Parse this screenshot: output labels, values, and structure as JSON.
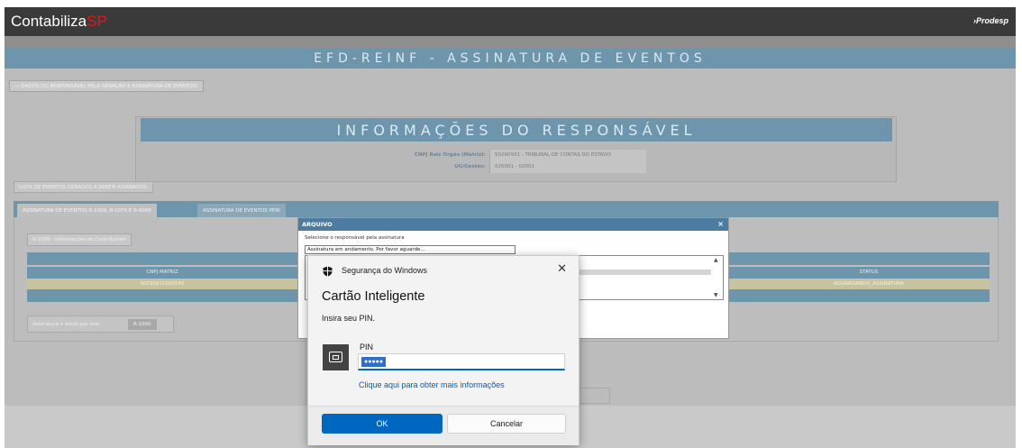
{
  "brand": {
    "name": "Contabiliza",
    "suffix": "SP",
    "partner": "Prodesp"
  },
  "page": {
    "title": "EFD-REINF - ASSINATURA DE EVENTOS",
    "section_dados": "DADOS DO RESPONSÁVEL PELA GERAÇÃO E ASSINATURA DE EVENTOS:",
    "responsavel": {
      "title": "INFORMAÇÕES DO RESPONSÁVEL",
      "rows": [
        {
          "label": "CNPJ Raiz Órgão (Matriz):",
          "value": "50290931 - TRIBUNAL DE CONTAS DO ESTADO"
        },
        {
          "label": "UG/Gestão:",
          "value": "020001 - 02001"
        }
      ]
    },
    "lista_label": "LISTA DE EVENTOS GERADOS A SEREM ASSINADOS:",
    "tabs": [
      {
        "label": "ASSINATURA DE EVENTOS R-1000, R-1070 E R-9000"
      },
      {
        "label": "ASSINATURA DE EVENTOS PERI"
      }
    ],
    "contribuinte_label": "R-1000 - Informações do Contribuinte",
    "table": {
      "headers": [
        "CNPJ MATRIZ",
        "STATUS"
      ],
      "row": [
        "50290931000140",
        "AGUARDANDO_ASSINATURA"
      ]
    },
    "lote_label": "Assinatura e envio por lote",
    "lote_button": "R-1000"
  },
  "arquivo_dialog": {
    "title": "ARQUIVO",
    "close": "×",
    "prompt": "Selecione o responsável pela assinatura",
    "status": "Assinatura em andamento. Por favor aguarde..."
  },
  "security_dialog": {
    "header": "Segurança do Windows",
    "close": "✕",
    "title": "Cartão Inteligente",
    "subtitle": "Insira seu PIN.",
    "pin_label": "PIN",
    "pin_value": "●●●●●",
    "link": "Clique aqui para obter mais informações",
    "ok": "OK",
    "cancel": "Cancelar"
  },
  "colors": {
    "topbar": "#3a3a3a",
    "brand_accent": "#e8141e",
    "title_band": "#6d96ac",
    "dialog_title": "#4e7ba0",
    "primary_button": "#0067c0"
  }
}
